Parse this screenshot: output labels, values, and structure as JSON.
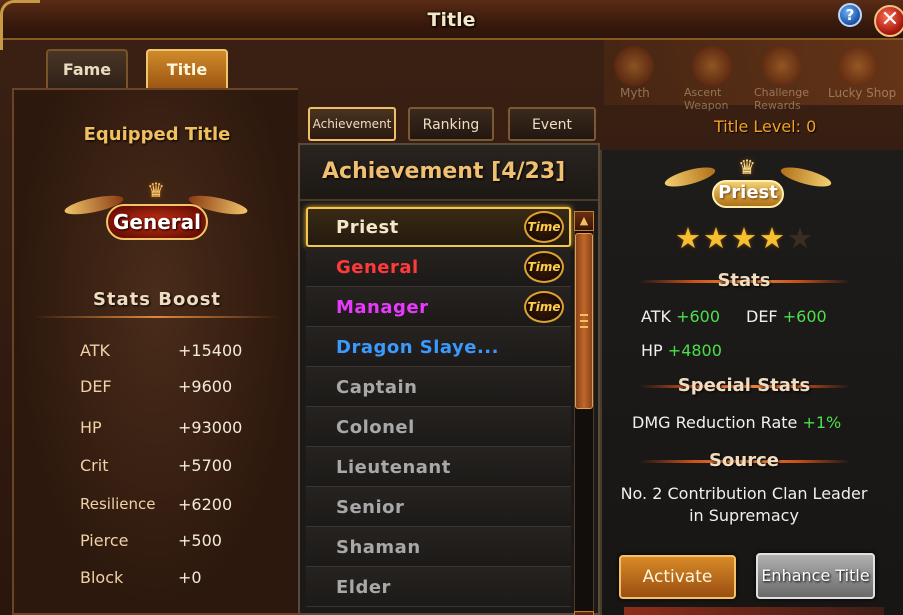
{
  "window": {
    "title": "Title"
  },
  "main_tabs": [
    {
      "label": "Fame",
      "active": false
    },
    {
      "label": "Title",
      "active": true
    }
  ],
  "background_labels": [
    "Myth",
    "Ascent Weapon",
    "Challenge Rewards",
    "Lucky Shop"
  ],
  "left": {
    "equipped_title_label": "Equipped Title",
    "equipped_badge": "General",
    "stats_boost_label": "Stats Boost",
    "stats": [
      {
        "key": "ATK",
        "value": "+15400"
      },
      {
        "key": "DEF",
        "value": "+9600"
      },
      {
        "key": "HP",
        "value": "+93000"
      },
      {
        "key": "Crit",
        "value": "+5700"
      },
      {
        "key": "Resilience",
        "value": "+6200"
      },
      {
        "key": "Pierce",
        "value": "+500"
      },
      {
        "key": "Block",
        "value": "+0"
      }
    ]
  },
  "sub_tabs": [
    {
      "label": "Achievement",
      "active": true
    },
    {
      "label": "Ranking",
      "active": false
    },
    {
      "label": "Event",
      "active": false
    }
  ],
  "list": {
    "header": "Achievement [4/23]",
    "time_label": "Time",
    "items": [
      {
        "name": "Priest",
        "color": "#f4e8c8",
        "time": true,
        "selected": true
      },
      {
        "name": "General",
        "color": "#ff3a3a",
        "time": true,
        "selected": false
      },
      {
        "name": "Manager",
        "color": "#e83aff",
        "time": true,
        "selected": false
      },
      {
        "name": "Dragon Slaye...",
        "color": "#3a9aff",
        "time": false,
        "selected": false
      },
      {
        "name": "Captain",
        "color": "#a8a8a8",
        "time": false,
        "selected": false
      },
      {
        "name": "Colonel",
        "color": "#a8a8a8",
        "time": false,
        "selected": false
      },
      {
        "name": "Lieutenant",
        "color": "#a8a8a8",
        "time": false,
        "selected": false
      },
      {
        "name": "Senior",
        "color": "#a8a8a8",
        "time": false,
        "selected": false
      },
      {
        "name": "Shaman",
        "color": "#a8a8a8",
        "time": false,
        "selected": false
      },
      {
        "name": "Elder",
        "color": "#a8a8a8",
        "time": false,
        "selected": false
      }
    ]
  },
  "detail": {
    "title_level": "Title Level: 0",
    "badge": "Priest",
    "stars_filled": 4,
    "stars_total": 5,
    "stats_label": "Stats",
    "atk_key": "ATK",
    "atk_val": "+600",
    "def_key": "DEF",
    "def_val": "+600",
    "hp_key": "HP",
    "hp_val": "+4800",
    "special_label": "Special Stats",
    "special_key": "DMG Reduction Rate",
    "special_val": "+1%",
    "source_label": "Source",
    "source_text_1": "No. 2 Contribution Clan Leader",
    "source_text_2": "in Supremacy",
    "activate_label": "Activate",
    "enhance_label": "Enhance Title"
  }
}
